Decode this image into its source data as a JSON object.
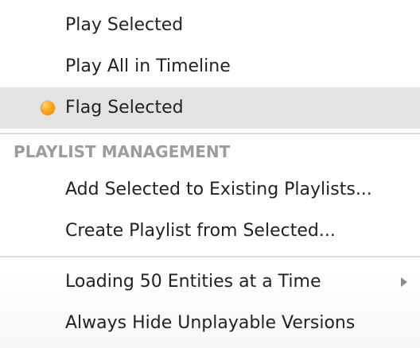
{
  "menu": {
    "items_top": [
      {
        "label": "Play Selected"
      },
      {
        "label": "Play All in Timeline"
      },
      {
        "label": "Flag Selected",
        "highlighted": true,
        "marker_color": "#ffa41a"
      }
    ],
    "playlist_section": {
      "header": "PLAYLIST MANAGEMENT",
      "items": [
        {
          "label": "Add Selected to Existing Playlists..."
        },
        {
          "label": "Create Playlist from Selected..."
        }
      ]
    },
    "items_bottom": [
      {
        "label": "Loading 50 Entities at a Time",
        "has_submenu": true
      },
      {
        "label": "Always Hide Unplayable Versions"
      }
    ]
  },
  "colors": {
    "highlight": "#e3e3e3",
    "section_header": "#9c9c9c",
    "text": "#222222",
    "flag_marker": "#ffa41a"
  }
}
